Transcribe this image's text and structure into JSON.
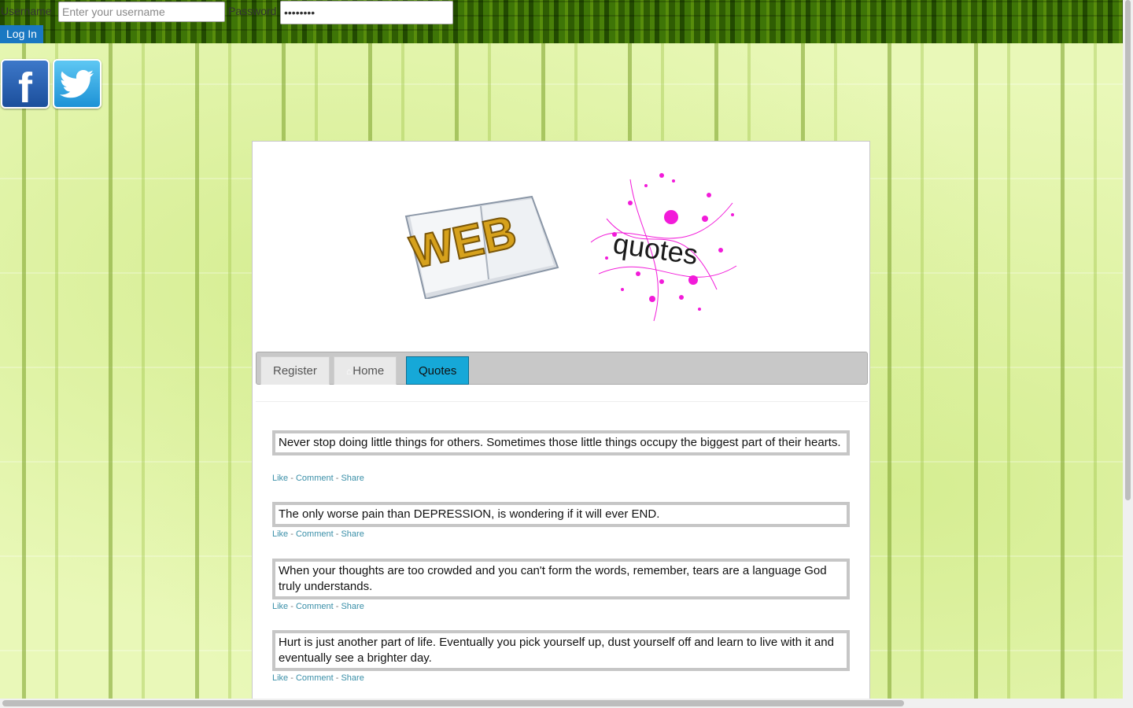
{
  "login": {
    "username_label": "Username",
    "username_placeholder": "Enter your username",
    "password_label": "Password",
    "password_value": "••••••••",
    "login_button": "Log In"
  },
  "social": {
    "facebook_icon": "facebook-icon",
    "twitter_icon": "twitter-icon"
  },
  "logo": {
    "book_text": "WEB",
    "quotes_text": "quotes"
  },
  "nav": {
    "tabs": [
      {
        "label": "Register"
      },
      {
        "label": "Home"
      },
      {
        "label": "Quotes",
        "active": true
      }
    ],
    "active_color": "#16a8d8"
  },
  "quotes": [
    {
      "text": "Never stop doing little things for others. Sometimes those little things occupy the biggest part of their hearts."
    },
    {
      "text": "The only worse pain than DEPRESSION, is wondering if it will ever END."
    },
    {
      "text": "When your thoughts are too crowded and you can't form the words, remember, tears are a language God truly understands."
    },
    {
      "text": "Hurt is just another part of life. Eventually you pick yourself up, dust yourself off and learn to live with it and eventually see a brighter day."
    }
  ],
  "actions": {
    "like": "Like",
    "comment": "Comment",
    "share": "Share",
    "separator": "-"
  }
}
